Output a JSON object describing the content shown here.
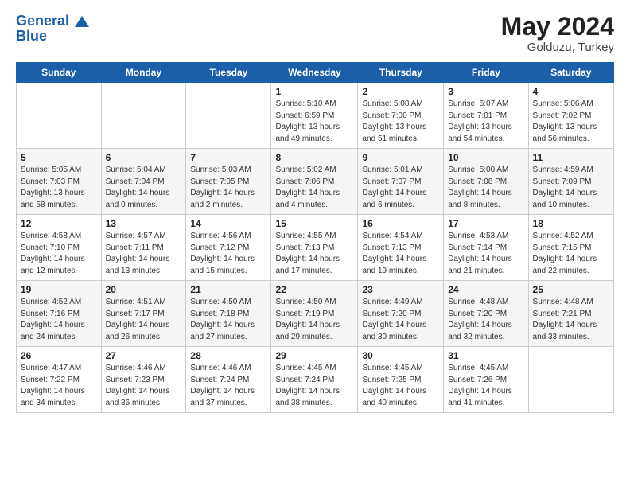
{
  "header": {
    "logo_line1": "General",
    "logo_line2": "Blue",
    "month": "May 2024",
    "location": "Golduzu, Turkey"
  },
  "weekdays": [
    "Sunday",
    "Monday",
    "Tuesday",
    "Wednesday",
    "Thursday",
    "Friday",
    "Saturday"
  ],
  "weeks": [
    [
      {
        "day": "",
        "sunrise": "",
        "sunset": "",
        "daylight": ""
      },
      {
        "day": "",
        "sunrise": "",
        "sunset": "",
        "daylight": ""
      },
      {
        "day": "",
        "sunrise": "",
        "sunset": "",
        "daylight": ""
      },
      {
        "day": "1",
        "sunrise": "Sunrise: 5:10 AM",
        "sunset": "Sunset: 6:59 PM",
        "daylight": "Daylight: 13 hours and 49 minutes."
      },
      {
        "day": "2",
        "sunrise": "Sunrise: 5:08 AM",
        "sunset": "Sunset: 7:00 PM",
        "daylight": "Daylight: 13 hours and 51 minutes."
      },
      {
        "day": "3",
        "sunrise": "Sunrise: 5:07 AM",
        "sunset": "Sunset: 7:01 PM",
        "daylight": "Daylight: 13 hours and 54 minutes."
      },
      {
        "day": "4",
        "sunrise": "Sunrise: 5:06 AM",
        "sunset": "Sunset: 7:02 PM",
        "daylight": "Daylight: 13 hours and 56 minutes."
      }
    ],
    [
      {
        "day": "5",
        "sunrise": "Sunrise: 5:05 AM",
        "sunset": "Sunset: 7:03 PM",
        "daylight": "Daylight: 13 hours and 58 minutes."
      },
      {
        "day": "6",
        "sunrise": "Sunrise: 5:04 AM",
        "sunset": "Sunset: 7:04 PM",
        "daylight": "Daylight: 14 hours and 0 minutes."
      },
      {
        "day": "7",
        "sunrise": "Sunrise: 5:03 AM",
        "sunset": "Sunset: 7:05 PM",
        "daylight": "Daylight: 14 hours and 2 minutes."
      },
      {
        "day": "8",
        "sunrise": "Sunrise: 5:02 AM",
        "sunset": "Sunset: 7:06 PM",
        "daylight": "Daylight: 14 hours and 4 minutes."
      },
      {
        "day": "9",
        "sunrise": "Sunrise: 5:01 AM",
        "sunset": "Sunset: 7:07 PM",
        "daylight": "Daylight: 14 hours and 6 minutes."
      },
      {
        "day": "10",
        "sunrise": "Sunrise: 5:00 AM",
        "sunset": "Sunset: 7:08 PM",
        "daylight": "Daylight: 14 hours and 8 minutes."
      },
      {
        "day": "11",
        "sunrise": "Sunrise: 4:59 AM",
        "sunset": "Sunset: 7:09 PM",
        "daylight": "Daylight: 14 hours and 10 minutes."
      }
    ],
    [
      {
        "day": "12",
        "sunrise": "Sunrise: 4:58 AM",
        "sunset": "Sunset: 7:10 PM",
        "daylight": "Daylight: 14 hours and 12 minutes."
      },
      {
        "day": "13",
        "sunrise": "Sunrise: 4:57 AM",
        "sunset": "Sunset: 7:11 PM",
        "daylight": "Daylight: 14 hours and 13 minutes."
      },
      {
        "day": "14",
        "sunrise": "Sunrise: 4:56 AM",
        "sunset": "Sunset: 7:12 PM",
        "daylight": "Daylight: 14 hours and 15 minutes."
      },
      {
        "day": "15",
        "sunrise": "Sunrise: 4:55 AM",
        "sunset": "Sunset: 7:13 PM",
        "daylight": "Daylight: 14 hours and 17 minutes."
      },
      {
        "day": "16",
        "sunrise": "Sunrise: 4:54 AM",
        "sunset": "Sunset: 7:13 PM",
        "daylight": "Daylight: 14 hours and 19 minutes."
      },
      {
        "day": "17",
        "sunrise": "Sunrise: 4:53 AM",
        "sunset": "Sunset: 7:14 PM",
        "daylight": "Daylight: 14 hours and 21 minutes."
      },
      {
        "day": "18",
        "sunrise": "Sunrise: 4:52 AM",
        "sunset": "Sunset: 7:15 PM",
        "daylight": "Daylight: 14 hours and 22 minutes."
      }
    ],
    [
      {
        "day": "19",
        "sunrise": "Sunrise: 4:52 AM",
        "sunset": "Sunset: 7:16 PM",
        "daylight": "Daylight: 14 hours and 24 minutes."
      },
      {
        "day": "20",
        "sunrise": "Sunrise: 4:51 AM",
        "sunset": "Sunset: 7:17 PM",
        "daylight": "Daylight: 14 hours and 26 minutes."
      },
      {
        "day": "21",
        "sunrise": "Sunrise: 4:50 AM",
        "sunset": "Sunset: 7:18 PM",
        "daylight": "Daylight: 14 hours and 27 minutes."
      },
      {
        "day": "22",
        "sunrise": "Sunrise: 4:50 AM",
        "sunset": "Sunset: 7:19 PM",
        "daylight": "Daylight: 14 hours and 29 minutes."
      },
      {
        "day": "23",
        "sunrise": "Sunrise: 4:49 AM",
        "sunset": "Sunset: 7:20 PM",
        "daylight": "Daylight: 14 hours and 30 minutes."
      },
      {
        "day": "24",
        "sunrise": "Sunrise: 4:48 AM",
        "sunset": "Sunset: 7:20 PM",
        "daylight": "Daylight: 14 hours and 32 minutes."
      },
      {
        "day": "25",
        "sunrise": "Sunrise: 4:48 AM",
        "sunset": "Sunset: 7:21 PM",
        "daylight": "Daylight: 14 hours and 33 minutes."
      }
    ],
    [
      {
        "day": "26",
        "sunrise": "Sunrise: 4:47 AM",
        "sunset": "Sunset: 7:22 PM",
        "daylight": "Daylight: 14 hours and 34 minutes."
      },
      {
        "day": "27",
        "sunrise": "Sunrise: 4:46 AM",
        "sunset": "Sunset: 7:23 PM",
        "daylight": "Daylight: 14 hours and 36 minutes."
      },
      {
        "day": "28",
        "sunrise": "Sunrise: 4:46 AM",
        "sunset": "Sunset: 7:24 PM",
        "daylight": "Daylight: 14 hours and 37 minutes."
      },
      {
        "day": "29",
        "sunrise": "Sunrise: 4:45 AM",
        "sunset": "Sunset: 7:24 PM",
        "daylight": "Daylight: 14 hours and 38 minutes."
      },
      {
        "day": "30",
        "sunrise": "Sunrise: 4:45 AM",
        "sunset": "Sunset: 7:25 PM",
        "daylight": "Daylight: 14 hours and 40 minutes."
      },
      {
        "day": "31",
        "sunrise": "Sunrise: 4:45 AM",
        "sunset": "Sunset: 7:26 PM",
        "daylight": "Daylight: 14 hours and 41 minutes."
      },
      {
        "day": "",
        "sunrise": "",
        "sunset": "",
        "daylight": ""
      }
    ]
  ]
}
